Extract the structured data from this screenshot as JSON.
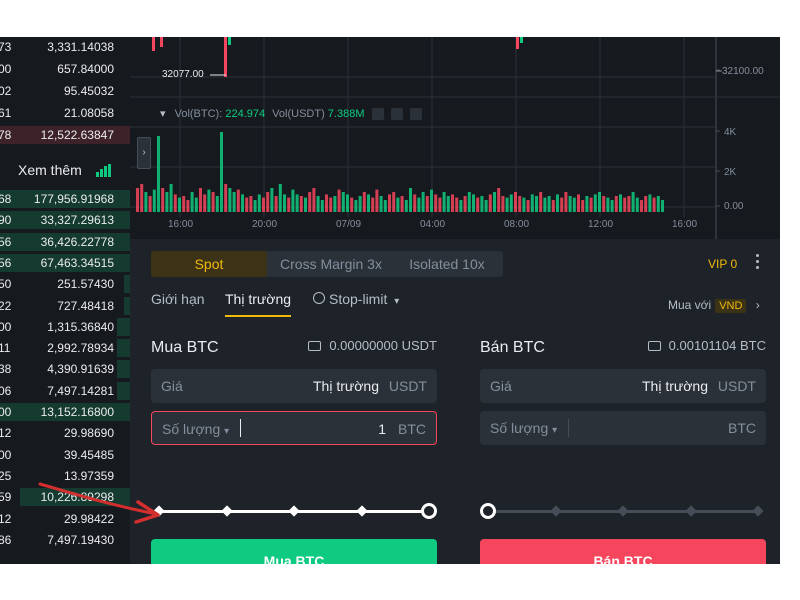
{
  "orderbook": {
    "rows": [
      {
        "left": "73",
        "right": "3,331.14038",
        "bar": 0.0,
        "color": "none"
      },
      {
        "left": "00",
        "right": "657.84000",
        "bar": 0.0,
        "color": "none"
      },
      {
        "left": "02",
        "right": "95.45032",
        "bar": 0.0,
        "color": "none"
      },
      {
        "left": "61",
        "right": "21.08058",
        "bar": 0.0,
        "color": "none"
      },
      {
        "left": "78",
        "right": "12,522.63847",
        "bar": 1.0,
        "color": "red"
      },
      {
        "left": "68",
        "right": "177,956.91968",
        "bar": 1.0,
        "color": "green"
      },
      {
        "left": "90",
        "right": "33,327.29613",
        "bar": 1.0,
        "color": "green"
      },
      {
        "left": "56",
        "right": "36,426.22778",
        "bar": 1.0,
        "color": "green"
      },
      {
        "left": "56",
        "right": "67,463.34515",
        "bar": 1.0,
        "color": "green"
      },
      {
        "left": "50",
        "right": "251.57430",
        "bar": 0.05,
        "color": "green"
      },
      {
        "left": "22",
        "right": "727.48418",
        "bar": 0.05,
        "color": "green"
      },
      {
        "left": "00",
        "right": "1,315.36840",
        "bar": 0.1,
        "color": "green"
      },
      {
        "left": "11",
        "right": "2,992.78934",
        "bar": 0.1,
        "color": "green"
      },
      {
        "left": "38",
        "right": "4,390.91639",
        "bar": 0.1,
        "color": "green"
      },
      {
        "left": "06",
        "right": "7,497.14281",
        "bar": 0.1,
        "color": "green"
      },
      {
        "left": "00",
        "right": "13,152.16800",
        "bar": 1.0,
        "color": "green"
      },
      {
        "left": "12",
        "right": "29.98690",
        "bar": 0.0,
        "color": "none"
      },
      {
        "left": "00",
        "right": "39.45485",
        "bar": 0.0,
        "color": "none"
      },
      {
        "left": "25",
        "right": "13.97359",
        "bar": 0.0,
        "color": "none"
      },
      {
        "left": "59",
        "right": "10,226.89298",
        "bar": 0.85,
        "color": "green"
      },
      {
        "left": "12",
        "right": "29.98422",
        "bar": 0.0,
        "color": "none"
      },
      {
        "left": "86",
        "right": "7,497.19430",
        "bar": 0.0,
        "color": "none"
      }
    ],
    "see_more": "Xem thêm"
  },
  "chart": {
    "price_low_label": "32077.00",
    "price_axis": [
      "32100.00"
    ],
    "vol_legend": {
      "label1": "Vol(BTC):",
      "value1": "224.974",
      "label2": "Vol(USDT)",
      "value2": "7.388M"
    },
    "vol_axis": [
      "4K",
      "2K",
      "0.00"
    ],
    "time_axis": [
      "16:00",
      "20:00",
      "07/09",
      "04:00",
      "08:00",
      "12:00",
      "16:00"
    ],
    "volume_bars": [
      30,
      35,
      25,
      20,
      28,
      95,
      30,
      25,
      35,
      22,
      18,
      20,
      15,
      25,
      18,
      30,
      22,
      28,
      25,
      20,
      100,
      35,
      30,
      25,
      28,
      22,
      18,
      20,
      15,
      22,
      18,
      25,
      30,
      20,
      35,
      22,
      18,
      28,
      22,
      20,
      18,
      25,
      30,
      20,
      15,
      22,
      18,
      20,
      28,
      25,
      22,
      18,
      15,
      20,
      25,
      22,
      18,
      28,
      20,
      15,
      22,
      25,
      18,
      20,
      15,
      30,
      22,
      18,
      25,
      20,
      28,
      22,
      18,
      25,
      20,
      22,
      18,
      15,
      20,
      25,
      22,
      18,
      20,
      15,
      22,
      25,
      30,
      20,
      18,
      22,
      25,
      20,
      18,
      15,
      22,
      20,
      25,
      18,
      20,
      15,
      22,
      18,
      25,
      20,
      18,
      22,
      15,
      20,
      18,
      22,
      25,
      20,
      18,
      15,
      20,
      22,
      18,
      20,
      25,
      18,
      15,
      20,
      22,
      18,
      20,
      15
    ],
    "colors": {
      "up": "#0ecb81",
      "down": "#f6465d"
    }
  },
  "trade": {
    "tabs": [
      "Spot",
      "Cross Margin 3x",
      "Isolated 10x"
    ],
    "vip": "VIP 0",
    "order_types": {
      "limit": "Giới hạn",
      "market": "Thị trường",
      "stop_limit": "Stop-limit"
    },
    "buy_with": "Mua với",
    "currency": "VND",
    "buy": {
      "title": "Mua BTC",
      "balance": "0.00000000 USDT",
      "price_label": "Giá",
      "price_value": "Thị trường",
      "price_unit": "USDT",
      "amount_label": "Số lượng",
      "amount_value": "1",
      "amount_unit": "BTC",
      "slider_pct": 100,
      "button": "Mua BTC"
    },
    "sell": {
      "title": "Bán BTC",
      "balance": "0.00101104 BTC",
      "price_label": "Giá",
      "price_value": "Thị trường",
      "price_unit": "USDT",
      "amount_label": "Số lượng",
      "amount_value": "",
      "amount_unit": "BTC",
      "slider_pct": 0,
      "button": "Bán BTC"
    }
  }
}
